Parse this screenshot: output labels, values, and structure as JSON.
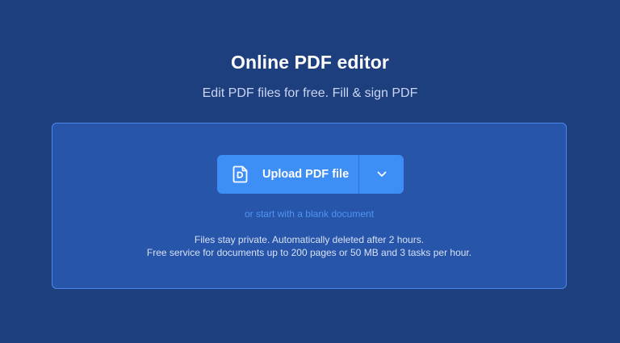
{
  "header": {
    "title": "Online PDF editor",
    "subtitle": "Edit PDF files for free. Fill & sign PDF"
  },
  "upload": {
    "button_label": "Upload PDF file",
    "icon": "pdf-file-icon",
    "dropdown_icon": "chevron-down-icon",
    "blank_link": "or start with a blank document"
  },
  "info": {
    "line1": "Files stay private. Automatically deleted after 2 hours.",
    "line2": "Free service for documents up to 200 pages or 50 MB and 3 tasks per hour."
  },
  "colors": {
    "background": "#1e3f7e",
    "dropzone": "#2755a9",
    "dropzone_border": "#4c86ea",
    "button": "#3d8ef5",
    "link": "#4f95f2"
  }
}
